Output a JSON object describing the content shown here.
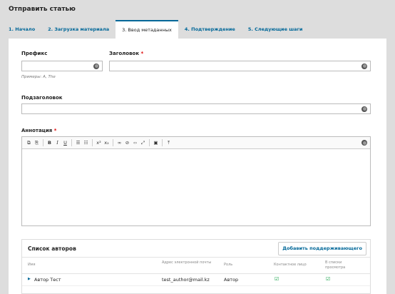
{
  "page": {
    "title": "Отправить статью"
  },
  "tabs": [
    {
      "label": "1. Начало"
    },
    {
      "label": "2. Загрузка материала"
    },
    {
      "label": "3. Ввод метаданных"
    },
    {
      "label": "4. Подтверждение"
    },
    {
      "label": "5. Следующие шаги"
    }
  ],
  "active_tab": 2,
  "form": {
    "prefix": {
      "label": "Префикс",
      "value": "",
      "hint": "Примеры: A, The"
    },
    "title": {
      "label": "Заголовок",
      "required_mark": "*",
      "value": ""
    },
    "subtitle": {
      "label": "Подзаголовок",
      "value": ""
    },
    "abstract": {
      "label": "Аннотация",
      "required_mark": "*",
      "value": "",
      "toolbar": [
        "copy-icon",
        "paste-icon",
        "bold-icon",
        "italic-icon",
        "underline-icon",
        "bullet-list-icon",
        "numbered-list-icon",
        "superscript-icon",
        "subscript-icon",
        "link-icon",
        "unlink-icon",
        "code-icon",
        "fullscreen-icon",
        "image-icon",
        "upload-icon"
      ]
    }
  },
  "authors": {
    "title": "Список авторов",
    "add_button": "Добавить поддерживающего",
    "columns": {
      "name": "Имя",
      "email": "Адрес электронной почты",
      "role": "Роль",
      "contact": "Контактное лицо",
      "listing": "В списки просмотра"
    },
    "rows": [
      {
        "name": "Автор Тест",
        "email": "test_author@mail.kz",
        "role": "Автор",
        "contact": true,
        "listing": true
      }
    ]
  },
  "colors": {
    "accent": "#006798",
    "required": "#dd0000",
    "check": "#19a34a"
  }
}
